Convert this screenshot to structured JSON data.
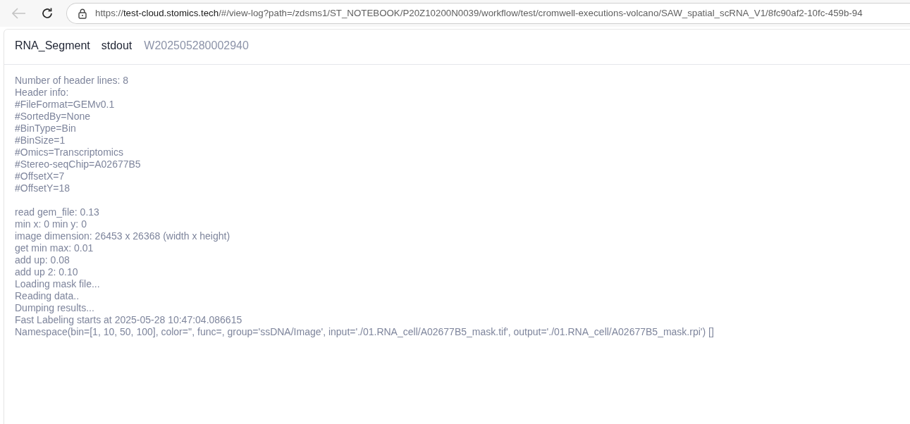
{
  "browser": {
    "back_disabled": true,
    "url": {
      "scheme": "https://",
      "host": "test-cloud.stomics.tech",
      "path": "/#/view-log?path=/zdsms1/ST_NOTEBOOK/P20Z10200N0039/workflow/test/cromwell-executions-volcano/SAW_spatial_scRNA_V1/8fc90af2-10fc-459b-94"
    }
  },
  "header": {
    "task": "RNA_Segment",
    "stream": "stdout",
    "id": "W202505280002940"
  },
  "log_blocks": [
    [
      "Number of header lines: 8",
      "Header info:",
      "#FileFormat=GEMv0.1",
      "#SortedBy=None",
      "#BinType=Bin",
      "#BinSize=1",
      "#Omics=Transcriptomics",
      "#Stereo-seqChip=A02677B5",
      "#OffsetX=7",
      "#OffsetY=18"
    ],
    [
      "read gem_file: 0.13",
      "min x: 0 min y: 0",
      "image dimension: 26453 x 26368 (width x height)",
      "get min max: 0.01",
      "add up: 0.08",
      "add up 2: 0.10",
      "Loading mask file...",
      "Reading data..",
      "Dumping results...",
      "Fast Labeling starts at 2025-05-28 10:47:04.086615",
      "Namespace(bin=[1, 10, 50, 100], color='', func=, group='ssDNA/Image', input='./01.RNA_cell/A02677B5_mask.tif', output='./01.RNA_cell/A02677B5_mask.rpi') []"
    ]
  ]
}
